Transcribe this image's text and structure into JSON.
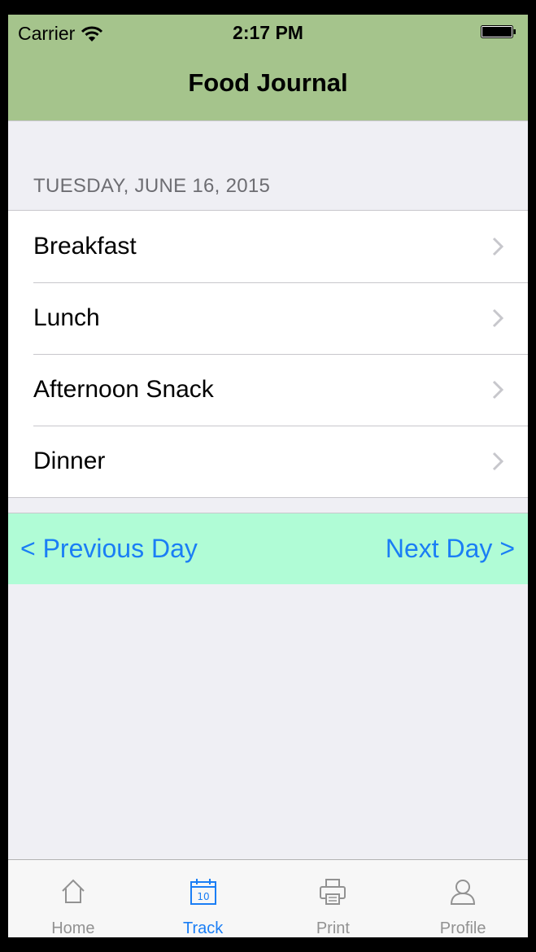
{
  "status_bar": {
    "carrier": "Carrier",
    "time": "2:17 PM"
  },
  "nav": {
    "title": "Food Journal"
  },
  "section": {
    "header": "TUESDAY, JUNE 16, 2015"
  },
  "meals": [
    {
      "label": "Breakfast"
    },
    {
      "label": "Lunch"
    },
    {
      "label": "Afternoon Snack"
    },
    {
      "label": "Dinner"
    }
  ],
  "day_nav": {
    "previous": "< Previous Day",
    "next": "Next Day >"
  },
  "tabs": [
    {
      "label": "Home",
      "icon": "home-icon",
      "active": false
    },
    {
      "label": "Track",
      "icon": "calendar-icon",
      "active": true
    },
    {
      "label": "Print",
      "icon": "printer-icon",
      "active": false
    },
    {
      "label": "Profile",
      "icon": "profile-icon",
      "active": false
    }
  ],
  "colors": {
    "nav_bar": "#a5c48c",
    "day_nav_bar": "#b0fcd6",
    "accent": "#1a7ef5",
    "inactive_tab": "#929292"
  }
}
